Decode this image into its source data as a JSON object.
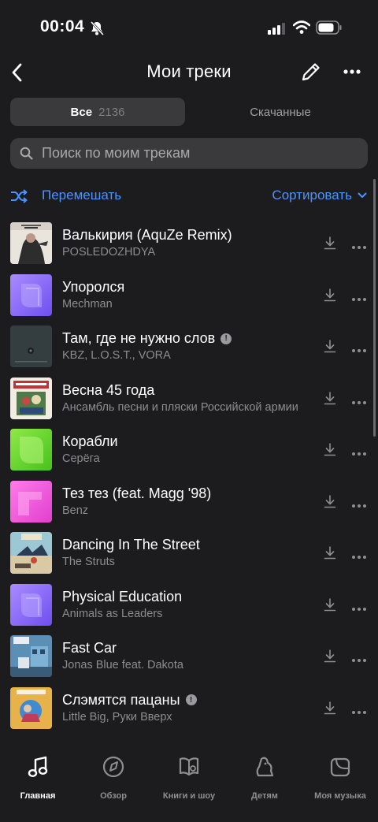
{
  "status": {
    "time": "00:04"
  },
  "header": {
    "title": "Мои треки"
  },
  "tabs": {
    "all_label": "Все",
    "all_count": "2136",
    "downloaded_label": "Скачанные"
  },
  "search": {
    "placeholder": "Поиск по моим трекам"
  },
  "actions": {
    "shuffle_label": "Перемешать",
    "sort_label": "Сортировать"
  },
  "tracks": [
    {
      "title": "Валькирия (AquZe Remix)",
      "artist": "POSLEDOZHDYA",
      "explicit": false,
      "cover": "valkyria"
    },
    {
      "title": "Упоролся",
      "artist": "Mechman",
      "explicit": false,
      "cover": "purple"
    },
    {
      "title": "Там, где не нужно слов",
      "artist": "KBZ, L.O.S.T., VORA",
      "explicit": true,
      "cover": "dark"
    },
    {
      "title": "Весна 45 года",
      "artist": "Ансамбль песни и пляски Российской армии",
      "explicit": false,
      "cover": "pesni"
    },
    {
      "title": "Корабли",
      "artist": "Серёга",
      "explicit": false,
      "cover": "green"
    },
    {
      "title": "Тез тез (feat. Magg '98)",
      "artist": "Benz",
      "explicit": false,
      "cover": "pink"
    },
    {
      "title": "Dancing In The Street",
      "artist": "The Struts",
      "explicit": false,
      "cover": "struts"
    },
    {
      "title": "Physical Education",
      "artist": "Animals as Leaders",
      "explicit": false,
      "cover": "purple"
    },
    {
      "title": "Fast Car",
      "artist": "Jonas Blue feat. Dakota",
      "explicit": false,
      "cover": "fastcar"
    },
    {
      "title": "Слэмятся пацаны",
      "artist": "Little Big, Руки Вверх",
      "explicit": true,
      "cover": "slem"
    }
  ],
  "tab_bar": [
    {
      "label": "Главная",
      "icon": "music-note-icon",
      "active": true
    },
    {
      "label": "Обзор",
      "icon": "compass-icon",
      "active": false
    },
    {
      "label": "Книги и шоу",
      "icon": "book-icon",
      "active": false
    },
    {
      "label": "Детям",
      "icon": "kids-icon",
      "active": false
    },
    {
      "label": "Моя музыка",
      "icon": "collection-icon",
      "active": false
    }
  ],
  "colors": {
    "accent": "#4b94ff",
    "background": "#1c1c1e",
    "surface": "#3a3a3c"
  }
}
